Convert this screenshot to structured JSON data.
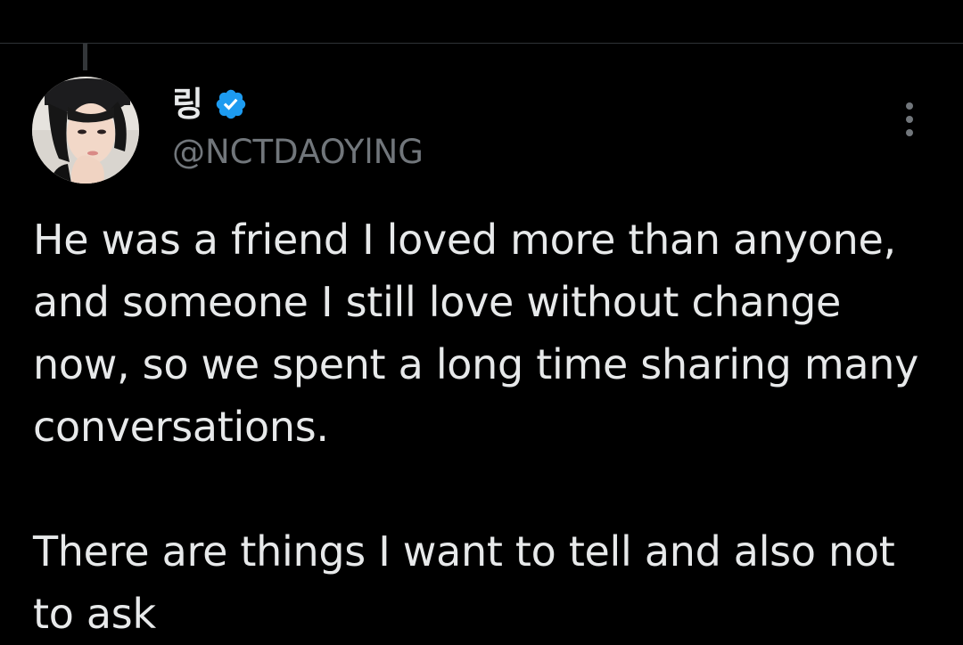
{
  "tweet": {
    "display_name": "링",
    "handle": "@NCTDAOYlNG",
    "verified": true,
    "paragraphs": [
      "He was a friend I loved more than anyone, and someone I still love without change now, so we spent a long time sharing many conversations.",
      "There are things I want to tell and also not to ask"
    ]
  },
  "icons": {
    "verified": "verified-badge-icon",
    "more": "more-options-icon"
  },
  "colors": {
    "background": "#000000",
    "text_primary": "#e7e9ea",
    "text_secondary": "#71767b",
    "verified_blue": "#1d9bf0",
    "divider": "#2f3336"
  }
}
